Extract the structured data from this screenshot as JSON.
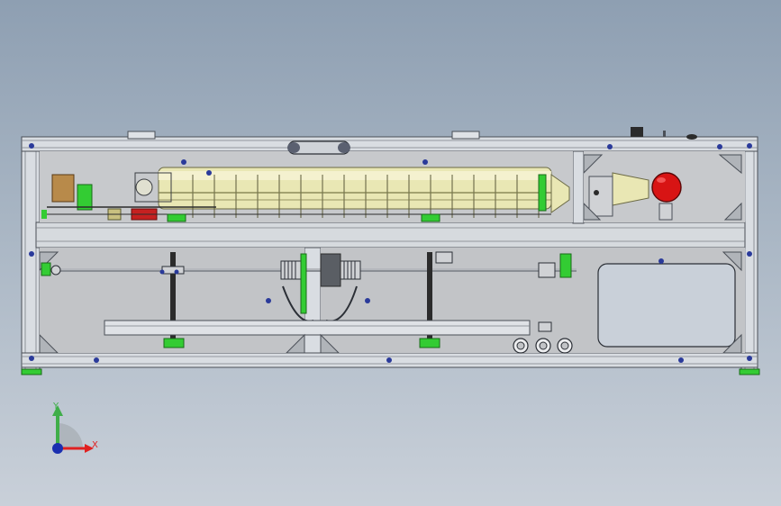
{
  "scene": {
    "view": "front",
    "colors": {
      "background_top": "#8e9fb2",
      "background_bottom": "#c9d0d9",
      "frame": "#d9dde2",
      "frame_edge": "#4a4f57",
      "panel": "#b9bcbf",
      "tube": "#e9e7b4",
      "lamp_red": "#d81414",
      "accent_green": "#33cc33",
      "fastener_blue": "#2a3a9a",
      "rubber_dark": "#2b2b2b"
    },
    "parts": [
      "aluminum-profile-frame",
      "laser-tube",
      "red-indicator-lamp",
      "lead-screw-shaft",
      "chain-drive",
      "shaft-couplings",
      "round-grommets",
      "leveling-feet"
    ]
  },
  "triad": {
    "y_label": "Y",
    "x_label": "X",
    "y_color": "#3fae49",
    "x_color": "#e02020",
    "origin_color": "#1a2fb0"
  }
}
